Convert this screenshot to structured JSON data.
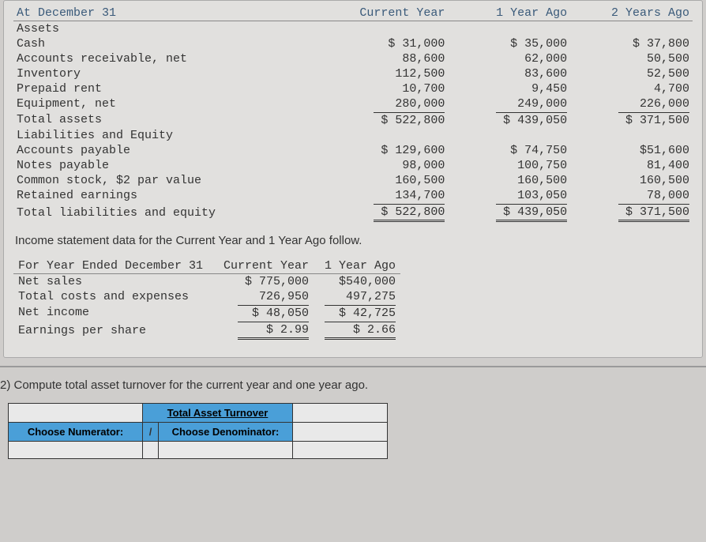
{
  "balance": {
    "header": {
      "c0": "At December 31",
      "c1": "Current Year",
      "c2": "1 Year Ago",
      "c3": "2 Years Ago"
    },
    "sections": {
      "assets_title": "Assets",
      "cash": {
        "label": "Cash",
        "cy": "$ 31,000",
        "y1": "$ 35,000",
        "y2": "$ 37,800"
      },
      "ar": {
        "label": "Accounts receivable, net",
        "cy": "88,600",
        "y1": "62,000",
        "y2": "50,500"
      },
      "inv": {
        "label": "Inventory",
        "cy": "112,500",
        "y1": "83,600",
        "y2": "52,500"
      },
      "prepaid": {
        "label": "Prepaid rent",
        "cy": "10,700",
        "y1": "9,450",
        "y2": "4,700"
      },
      "equip": {
        "label": "Equipment, net",
        "cy": "280,000",
        "y1": "249,000",
        "y2": "226,000"
      },
      "tot_assets": {
        "label": "Total assets",
        "cy": "$ 522,800",
        "y1": "$ 439,050",
        "y2": "$ 371,500"
      },
      "liab_title": "Liabilities and Equity",
      "ap": {
        "label": "Accounts payable",
        "cy": "$ 129,600",
        "y1": "$ 74,750",
        "y2": "$51,600"
      },
      "np": {
        "label": "Notes payable",
        "cy": "98,000",
        "y1": "100,750",
        "y2": "81,400"
      },
      "cs": {
        "label": "Common stock, $2 par value",
        "cy": "160,500",
        "y1": "160,500",
        "y2": "160,500"
      },
      "re": {
        "label": "Retained earnings",
        "cy": "134,700",
        "y1": "103,050",
        "y2": "78,000"
      },
      "tot_le": {
        "label": "Total liabilities and equity",
        "cy": "$ 522,800",
        "y1": "$ 439,050",
        "y2": "$ 371,500"
      }
    }
  },
  "income_note": "Income statement data for the Current Year and 1 Year Ago follow.",
  "income": {
    "header": {
      "c0": "For Year Ended December 31",
      "c1": "Current Year",
      "c2": "1 Year Ago"
    },
    "net_sales": {
      "label": "Net sales",
      "cy": "$ 775,000",
      "y1": "$540,000"
    },
    "costs": {
      "label": "Total costs and expenses",
      "cy": "726,950",
      "y1": "497,275"
    },
    "net_income": {
      "label": "Net income",
      "cy": "$ 48,050",
      "y1": "$ 42,725"
    },
    "eps": {
      "label": "Earnings per share",
      "cy": "$ 2.99",
      "y1": "$ 2.66"
    }
  },
  "question": {
    "prompt": "2) Compute total asset turnover for the current year and one year ago.",
    "table": {
      "title": "Total Asset Turnover",
      "numerator_label": "Choose Numerator:",
      "slash": "/",
      "denominator_label": "Choose Denominator:"
    }
  }
}
